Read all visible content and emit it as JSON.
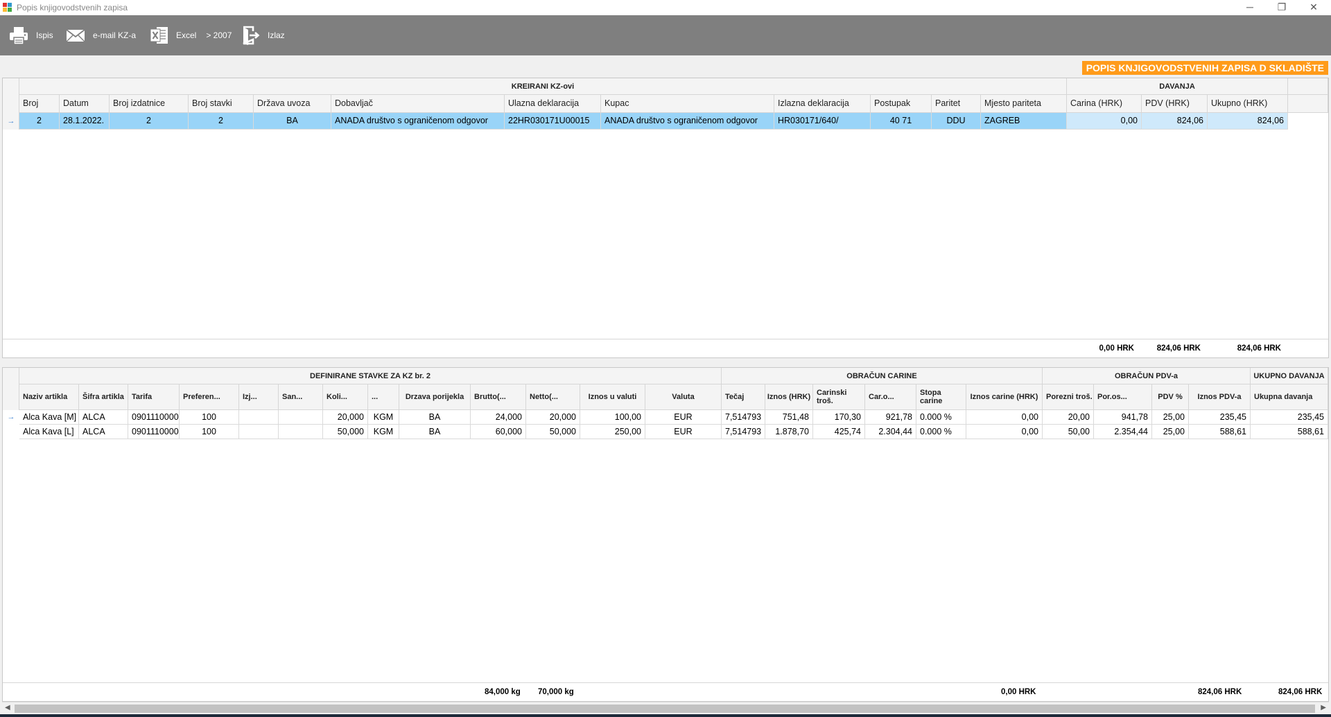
{
  "window": {
    "title": "Popis knjigovodstvenih zapisa",
    "min_glyph": "─",
    "max_glyph": "❐",
    "close_glyph": "✕"
  },
  "toolbar": {
    "print_label": "Ispis",
    "email_label": "e-mail KZ-a",
    "excel_label": "Excel",
    "excel_version": "> 2007",
    "exit_label": "Izlaz"
  },
  "page_title": "POPIS KNJIGOVODSTVENIH ZAPISA D SKLADIŠTE",
  "top_grid": {
    "band_created": "KREIRANI KZ-ovi",
    "band_duties": "DAVANJA",
    "columns": {
      "broj": "Broj",
      "datum": "Datum",
      "broj_izdatnice": "Broj izdatnice",
      "broj_stavki": "Broj stavki",
      "drzava_uvoza": "Država uvoza",
      "dobavljac": "Dobavljač",
      "ulazna_deklaracija": "Ulazna deklaracija",
      "kupac": "Kupac",
      "izlazna_deklaracija": "Izlazna deklaracija",
      "postupak": "Postupak",
      "paritet": "Paritet",
      "mjesto_pariteta": "Mjesto pariteta",
      "carina": "Carina (HRK)",
      "pdv": "PDV (HRK)",
      "ukupno": "Ukupno (HRK)"
    },
    "row": {
      "marker": "→",
      "broj": "2",
      "datum": "28.1.2022.",
      "broj_izdatnice": "2",
      "broj_stavki": "2",
      "drzava_uvoza": "BA",
      "dobavljac": "ANADA društvo s ograničenom odgovor",
      "ulazna_deklaracija": "22HR030171U00015",
      "kupac": "ANADA društvo s ograničenom odgovor",
      "izlazna_deklaracija": "HR030171/640/",
      "postupak": "40 71",
      "paritet": "DDU",
      "mjesto_pariteta": "ZAGREB",
      "carina": "0,00",
      "pdv": "824,06",
      "ukupno": "824,06"
    },
    "totals": {
      "carina": "0,00 HRK",
      "pdv": "824,06 HRK",
      "ukupno": "824,06 HRK"
    }
  },
  "bottom_grid": {
    "band_items": "DEFINIRANE STAVKE ZA KZ br. 2",
    "band_customs": "OBRAČUN CARINE",
    "band_vat": "OBRAČUN PDV-a",
    "band_total": "UKUPNO DAVANJA",
    "columns": {
      "naziv": "Naziv artikla",
      "sifra": "Šifra artikla",
      "tarifa": "Tarifa",
      "preferencija": "Preferen...",
      "izj": "Izj...",
      "san": "San...",
      "kolicina": "Koli...",
      "jm": "...",
      "drzava": "Drzava porijekla",
      "brutto": "Brutto(...",
      "netto": "Netto(...",
      "iznos_valuta": "Iznos u valuti",
      "valuta": "Valuta",
      "tecaj": "Tečaj",
      "iznos_hrk": "Iznos (HRK)",
      "carinski_tros": "Carinski troš.",
      "car_osnovica": "Car.o...",
      "stopa": "Stopa carine",
      "iznos_carine": "Iznos carine (HRK)",
      "porezni_tros": "Porezni troš.",
      "por_osnovica": "Por.os...",
      "pdv_posto": "PDV %",
      "iznos_pdv": "Iznos PDV-a",
      "ukupna_davanja": "Ukupna davanja"
    },
    "rows": [
      {
        "marker": "→",
        "naziv": "Alca Kava [M]",
        "sifra": "ALCA",
        "tarifa": "0901110000",
        "preferencija": "100",
        "izj": "",
        "san": "",
        "kolicina": "20,000",
        "jm": "KGM",
        "drzava": "BA",
        "brutto": "24,000",
        "netto": "20,000",
        "iznos_valuta": "100,00",
        "valuta": "EUR",
        "tecaj": "7,514793",
        "iznos_hrk": "751,48",
        "carinski_tros": "170,30",
        "car_osnovica": "921,78",
        "stopa": "0.000 %",
        "iznos_carine": "0,00",
        "porezni_tros": "20,00",
        "por_osnovica": "941,78",
        "pdv_posto": "25,00",
        "iznos_pdv": "235,45",
        "ukupna_davanja": "235,45"
      },
      {
        "marker": "",
        "naziv": "Alca Kava [L]",
        "sifra": "ALCA",
        "tarifa": "0901110000",
        "preferencija": "100",
        "izj": "",
        "san": "",
        "kolicina": "50,000",
        "jm": "KGM",
        "drzava": "BA",
        "brutto": "60,000",
        "netto": "50,000",
        "iznos_valuta": "250,00",
        "valuta": "EUR",
        "tecaj": "7,514793",
        "iznos_hrk": "1.878,70",
        "carinski_tros": "425,74",
        "car_osnovica": "2.304,44",
        "stopa": "0.000 %",
        "iznos_carine": "0,00",
        "porezni_tros": "50,00",
        "por_osnovica": "2.354,44",
        "pdv_posto": "25,00",
        "iznos_pdv": "588,61",
        "ukupna_davanja": "588,61"
      }
    ],
    "totals": {
      "brutto": "84,000 kg",
      "netto": "70,000 kg",
      "iznos_carine": "0,00 HRK",
      "iznos_pdv": "824,06 HRK",
      "ukupna_davanja": "824,06 HRK"
    }
  },
  "scrollbar": {
    "left_glyph": "◀",
    "right_glyph": "▶"
  },
  "colors": {
    "toolbar_bg": "#7f7f7f",
    "header_badge": "#ff9b1a",
    "selected_row": "#99d4f8"
  }
}
